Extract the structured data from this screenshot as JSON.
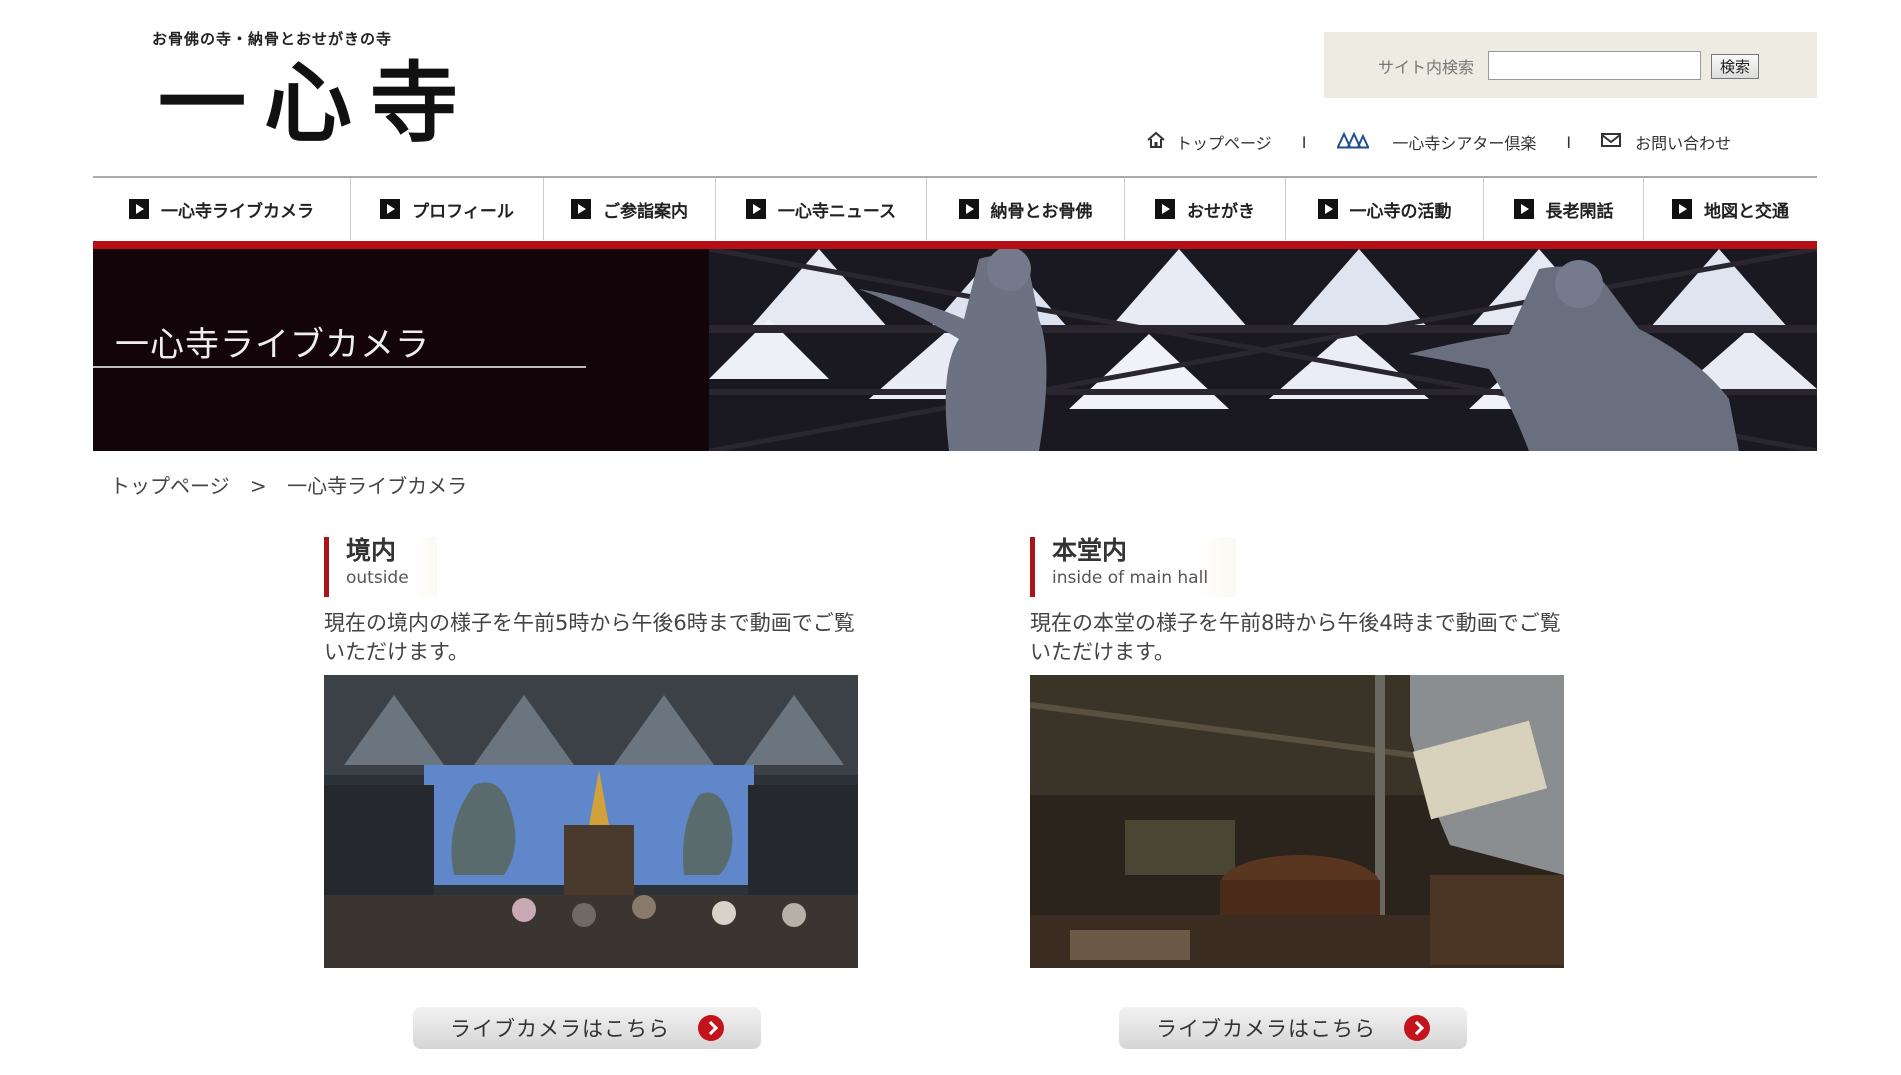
{
  "header": {
    "tagline": "お骨佛の寺・納骨とおせがきの寺",
    "logo": "一心寺"
  },
  "search": {
    "label": "サイト内検索",
    "value": "",
    "button": "検索"
  },
  "util_links": [
    {
      "label": "トップページ",
      "icon": "home-icon"
    },
    {
      "label": "一心寺シアター倶楽",
      "icon": "theater-icon"
    },
    {
      "label": "お問い合わせ",
      "icon": "mail-icon"
    }
  ],
  "util_separator": "I",
  "nav": [
    {
      "label": "一心寺ライブカメラ"
    },
    {
      "label": "プロフィール"
    },
    {
      "label": "ご参詣案内"
    },
    {
      "label": "一心寺ニュース"
    },
    {
      "label": "納骨とお骨佛"
    },
    {
      "label": "おせがき"
    },
    {
      "label": "一心寺の活動"
    },
    {
      "label": "長老閑話"
    },
    {
      "label": "地図と交通"
    }
  ],
  "hero": {
    "title": "一心寺ライブカメラ"
  },
  "breadcrumb": {
    "home": "トップページ",
    "sep": ">",
    "current": "一心寺ライブカメラ"
  },
  "cards": [
    {
      "title": "境内",
      "subtitle": "outside",
      "desc": "現在の境内の様子を午前5時から午後6時まで動画でご覧いただけます。",
      "button": "ライブカメラはこちら"
    },
    {
      "title": "本堂内",
      "subtitle": "inside of main hall",
      "desc": "現在の本堂の様子を午前8時から午後4時まで動画でご覧いただけます。",
      "button": "ライブカメラはこちら"
    }
  ],
  "colors": {
    "accent_red": "#b50e14",
    "hero_bg": "#130509",
    "search_bg": "#eeebe3"
  }
}
